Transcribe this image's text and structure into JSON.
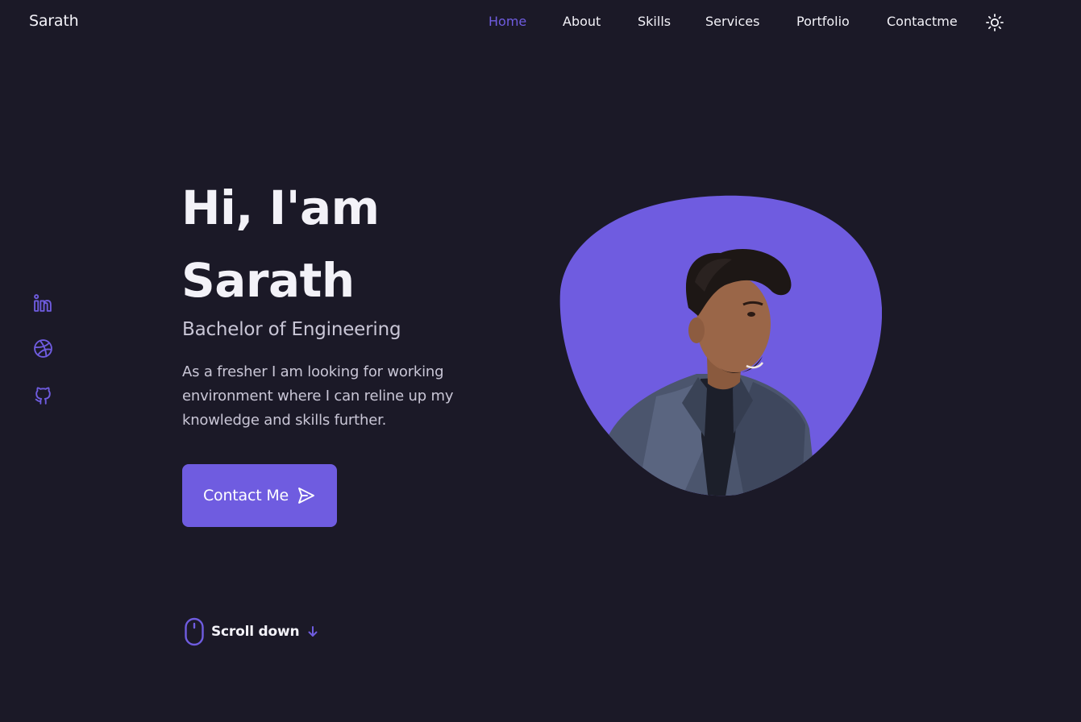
{
  "header": {
    "logo": "Sarath",
    "nav": [
      "Home",
      "About",
      "Skills",
      "Services",
      "Portfolio",
      "Contactme"
    ],
    "active_nav": "Home",
    "theme_icon": "sun-icon"
  },
  "socials": [
    {
      "icon": "linkedin-icon"
    },
    {
      "icon": "dribbble-icon"
    },
    {
      "icon": "github-icon"
    }
  ],
  "hero": {
    "title_line1": "Hi, I'am",
    "title_line2": "Sarath",
    "subtitle": "Bachelor of Engineering",
    "description": "As a fresher I am looking for working environment where I can reline up my knowledge and skills further.",
    "contact_button": "Contact Me",
    "contact_icon": "send-icon"
  },
  "scroll": {
    "label": "Scroll down",
    "mouse_icon": "mouse-icon",
    "arrow_icon": "arrow-down-icon"
  },
  "colors": {
    "background": "#1b1927",
    "accent": "#6f5ce0",
    "title": "#f3f2f8",
    "text": "#c9c6d6"
  }
}
